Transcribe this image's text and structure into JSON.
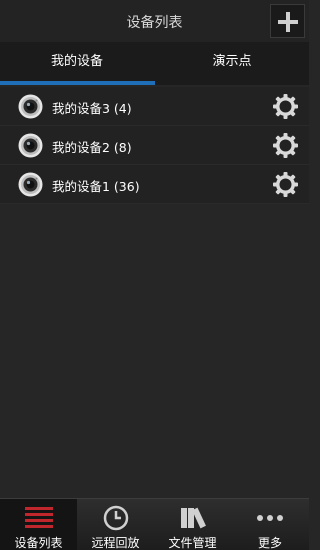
{
  "header": {
    "title": "设备列表",
    "add_icon": "plus-icon"
  },
  "tabs": [
    {
      "label": "我的设备",
      "active": true
    },
    {
      "label": "演示点",
      "active": false
    }
  ],
  "devices": [
    {
      "label": "我的设备3 (4)",
      "icon": "camera-icon",
      "action_icon": "gear-icon"
    },
    {
      "label": "我的设备2 (8)",
      "icon": "camera-icon",
      "action_icon": "gear-icon"
    },
    {
      "label": "我的设备1 (36)",
      "icon": "camera-icon",
      "action_icon": "gear-icon"
    }
  ],
  "bottom_nav": [
    {
      "label": "设备列表",
      "icon": "list-icon",
      "active": true
    },
    {
      "label": "远程回放",
      "icon": "clock-icon",
      "active": false
    },
    {
      "label": "文件管理",
      "icon": "files-icon",
      "active": false
    },
    {
      "label": "更多",
      "icon": "more-icon",
      "active": false
    }
  ],
  "colors": {
    "accent": "#1e6fb8",
    "active_nav_icon": "#c0272d",
    "background": "#262626"
  }
}
